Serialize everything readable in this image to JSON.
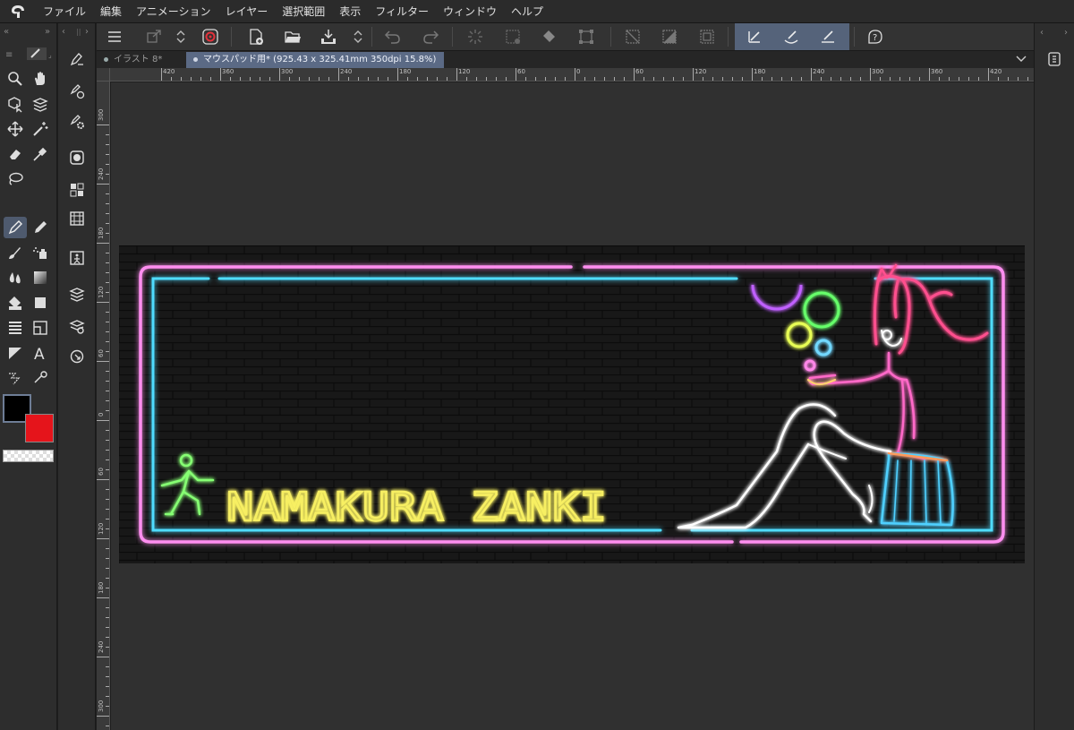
{
  "menu": {
    "items": [
      "ファイル",
      "編集",
      "アニメーション",
      "レイヤー",
      "選択範囲",
      "表示",
      "フィルター",
      "ウィンドウ",
      "ヘルプ"
    ]
  },
  "tabs": [
    {
      "label": "イラスト 8*",
      "active": false
    },
    {
      "label": "マウスパッド用* (925.43 x 325.41mm 350dpi 15.8%)",
      "active": true
    }
  ],
  "ruler": {
    "h_labels": [
      "420",
      "360",
      "300",
      "240",
      "180",
      "120",
      "60",
      "0",
      "60",
      "120",
      "180",
      "240",
      "300",
      "360",
      "420"
    ],
    "v_labels": [
      "300",
      "240",
      "180",
      "120",
      "60",
      "0",
      "60",
      "120",
      "180",
      "240",
      "300"
    ]
  },
  "canvas": {
    "title_text": "NAMAKURA ZANKI",
    "text_color": "#f5ec57",
    "frame_outer_color": "#ff7de8",
    "frame_inner_color": "#43d8ff",
    "brick_bg_color": "#161616",
    "running_man_color": "#7cff6a",
    "girl_line_color": "#ffffff",
    "hair_color": "#ff4fa0",
    "skirt_color": "#44ccff"
  },
  "colors": {
    "main": "#000000",
    "sub": "#e5141b"
  },
  "icons": {
    "tools": [
      "zoom-icon",
      "hand-icon",
      "object-icon",
      "layer-move-icon",
      "move-icon",
      "magic-wand-icon",
      "eraser-icon",
      "eyedropper-icon",
      "lasso-icon",
      "pen-icon",
      "pencil-icon",
      "brush-icon",
      "airbrush-icon",
      "blend-icon",
      "gradient-icon",
      "fill-icon",
      "figure-icon",
      "frame-icon",
      "ruler-icon",
      "text-icon",
      "balloon-icon",
      "line-fix-icon"
    ]
  }
}
